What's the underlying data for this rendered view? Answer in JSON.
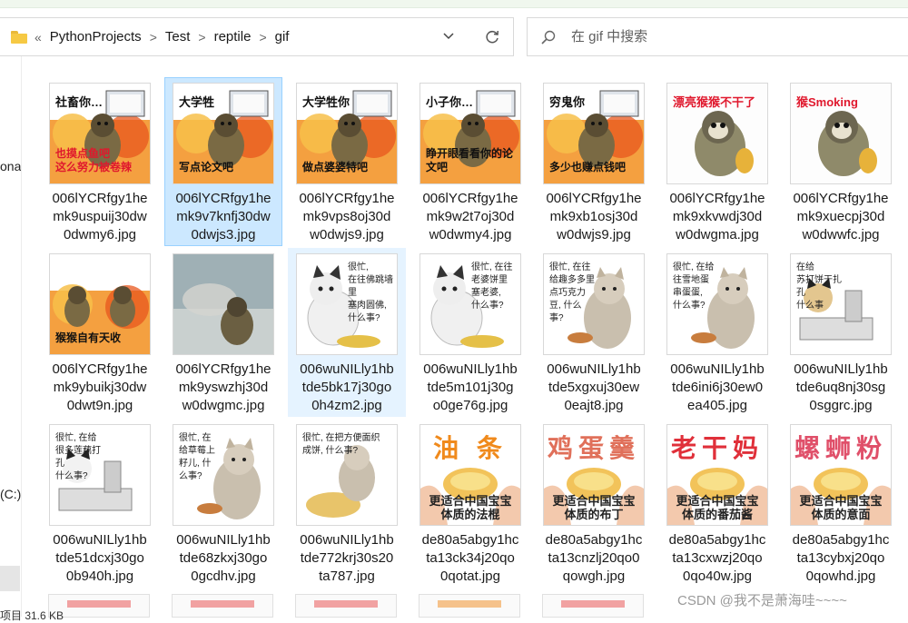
{
  "colors": {
    "selection_bg": "#cce8ff",
    "selection_border": "#99d1ff",
    "hover_bg": "#e5f3ff",
    "folder_icon": "#f6c944"
  },
  "address": {
    "overflow": "«",
    "crumbs": [
      "PythonProjects",
      "Test",
      "reptile",
      "gif"
    ],
    "separator": ">"
  },
  "search": {
    "placeholder": "在 gif 中搜索"
  },
  "nav": {
    "partial_item": "ona",
    "drive_label": "(C:)"
  },
  "status": {
    "text": "项目 31.6 KB"
  },
  "watermark": "CSDN @我不是萧海哇~~~~",
  "files": [
    {
      "name": "006lYCRfgy1he\nmk9uspuij30dw\n0dwmy6.jpg",
      "thumb": "monkey",
      "caption_top": "社畜你…",
      "caption_bottom": "也摸点鱼吧\n这么努力被卷辣",
      "laptop": true
    },
    {
      "name": "006lYCRfgy1he\nmk9v7knfj30dw\n0dwjs3.jpg",
      "thumb": "monkey",
      "caption_top": "大学牲",
      "caption_bottom": "写点论文吧",
      "laptop": true,
      "state": "selected"
    },
    {
      "name": "006lYCRfgy1he\nmk9vps8oj30d\nw0dwjs9.jpg",
      "thumb": "monkey",
      "caption_top": "大学牲你",
      "caption_bottom": "做点婆婆特吧",
      "laptop": true
    },
    {
      "name": "006lYCRfgy1he\nmk9w2t7oj30d\nw0dwmy4.jpg",
      "thumb": "monkey",
      "caption_top": "小子你…",
      "caption_bottom": "睁开眼看看你的论文吧",
      "laptop": true
    },
    {
      "name": "006lYCRfgy1he\nmk9xb1osj30d\nw0dwjs9.jpg",
      "thumb": "monkey",
      "caption_top": "穷鬼你",
      "caption_bottom": "多少也赚点钱吧",
      "laptop": true
    },
    {
      "name": "006lYCRfgy1he\nmk9xkvwdj30d\nw0dwgma.jpg",
      "thumb": "monkey-white",
      "caption_top": "漂亮猴猴不干了",
      "caption_bottom": ""
    },
    {
      "name": "006lYCRfgy1he\nmk9xuecpj30d\nw0dwwfc.jpg",
      "thumb": "monkey-white",
      "caption_top": "猴Smoking",
      "caption_bottom": ""
    },
    {
      "name": "006lYCRfgy1he\nmk9ybuikj30dw\n0dwt9n.jpg",
      "thumb": "monkey2",
      "caption_top": "",
      "caption_bottom": "猴猴自有天收"
    },
    {
      "name": "006lYCRfgy1he\nmk9yswzhj30d\nw0dwgmc.jpg",
      "thumb": "monkey-sea",
      "caption_top": "",
      "caption_bottom": ""
    },
    {
      "name": "006wuNILly1hb\ntde5bk17j30go\n0h4zm2.jpg",
      "thumb": "cat",
      "caption_top": "很忙,\n在往佛跳墙里\n塞肉圆佛,\n什么事?",
      "caption_bottom": "",
      "state": "hover"
    },
    {
      "name": "006wuNILly1hb\ntde5m101j30g\no0ge76g.jpg",
      "thumb": "cat",
      "caption_top": "很忙, 在往\n老婆饼里\n塞老婆,\n什么事?",
      "caption_bottom": ""
    },
    {
      "name": "006wuNILly1hb\ntde5xgxuj30ew\n0eajt8.jpg",
      "thumb": "cat-right",
      "caption_top": "很忙, 在往\n给趣多多里\n点巧克力\n豆, 什么\n事?",
      "caption_bottom": ""
    },
    {
      "name": "006wuNILly1hb\ntde6ini6j30ew0\nea405.jpg",
      "thumb": "cat-right",
      "caption_top": "很忙, 在给\n往雪地蛋\n串蛋蛋,\n什么事?",
      "caption_bottom": ""
    },
    {
      "name": "006wuNILly1hb\ntde6uq8nj30sg\n0sggrc.jpg",
      "thumb": "cat-sew",
      "caption_top": "在给\n苏打饼干扎孔\n什么事",
      "caption_bottom": ""
    },
    {
      "name": "006wuNILly1hb\ntde51dcxj30go\n0b940h.jpg",
      "thumb": "cat-sew2",
      "caption_top": "很忙, 在给\n很多莲藕打孔\n什么事?",
      "caption_bottom": ""
    },
    {
      "name": "006wuNILly1hb\ntde68zkxj30go\n0gcdhv.jpg",
      "thumb": "cat-right",
      "caption_top": "很忙, 在\n给草莓上\n籽儿, 什\n么事?",
      "caption_bottom": ""
    },
    {
      "name": "006wuNILly1hb\ntde772krj30s20\nta787.jpg",
      "thumb": "cat-noodle",
      "caption_top": "很忙, 在把方便面织\n成饼, 什么事?",
      "caption_bottom": ""
    },
    {
      "name": "de80a5abgy1hc\nta13ck34j20qo\n0qotat.jpg",
      "thumb": "food",
      "big": "油 条",
      "food_cap1": "更适合中国宝宝",
      "food_cap2": "体质的法棍",
      "word_color": "#f08a1c"
    },
    {
      "name": "de80a5abgy1hc\nta13cnzlj20qo0\nqowgh.jpg",
      "thumb": "food",
      "big": "鸡蛋羹",
      "food_cap1": "更适合中国宝宝",
      "food_cap2": "体质的布丁",
      "word_color": "#e0705a"
    },
    {
      "name": "de80a5abgy1hc\nta13cxwzj20qo\n0qo40w.jpg",
      "thumb": "food",
      "big": "老干妈",
      "food_cap1": "更适合中国宝宝",
      "food_cap2": "体质的番茄酱",
      "word_color": "#e0303a"
    },
    {
      "name": "de80a5abgy1hc\nta13cybxj20qo\n0qowhd.jpg",
      "thumb": "food",
      "big": "螺蛳粉",
      "food_cap1": "更适合中国宝宝",
      "food_cap2": "体质的意面",
      "word_color": "#e0506a"
    }
  ]
}
